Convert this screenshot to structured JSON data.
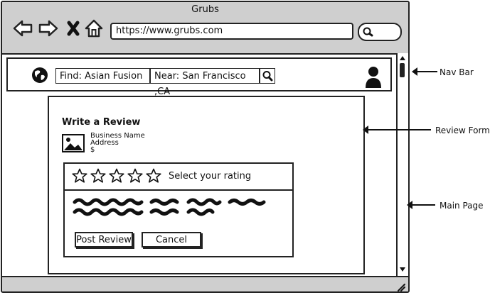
{
  "browser": {
    "title": "Grubs",
    "url": "https://www.grubs.com",
    "icons": [
      "back-arrow-icon",
      "forward-arrow-icon",
      "close-x-icon",
      "home-icon",
      "search-icon"
    ]
  },
  "navbar": {
    "find_label": "Find: Asian Fusion",
    "near_label": "Near: San Francisco ,CA"
  },
  "review_form": {
    "heading": "Write a Review",
    "business_name": "Business Name",
    "address": "Address",
    "price": "$",
    "rating_prompt": "Select your rating",
    "post_button": "Post Review",
    "cancel_button": "Cancel"
  },
  "annotations": {
    "nav_bar": "Nav Bar",
    "review_form": "Review Form",
    "main_page": "Main Page"
  }
}
